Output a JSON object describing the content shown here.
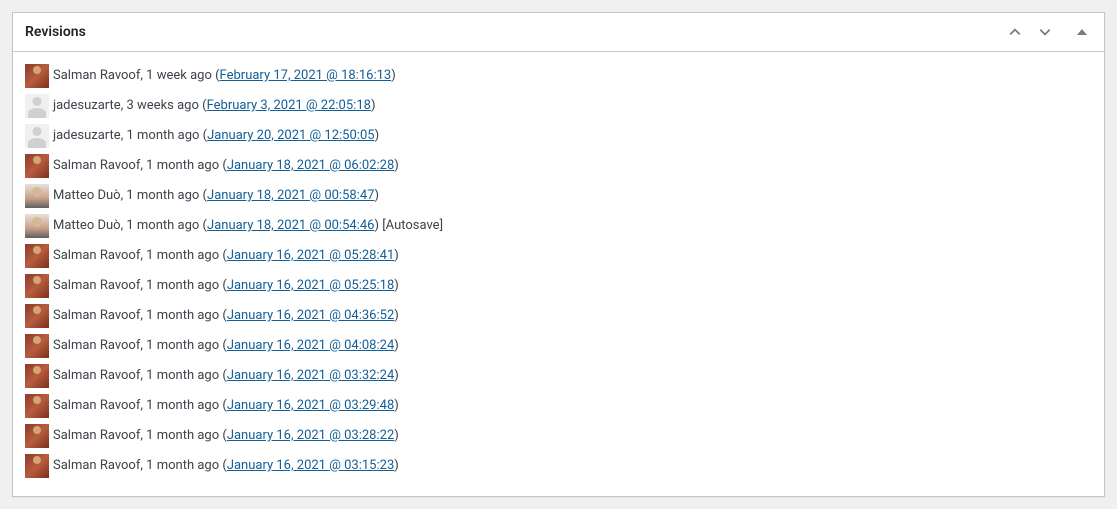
{
  "panel": {
    "title": "Revisions"
  },
  "revisions": [
    {
      "avatar": "sr",
      "author": "Salman Ravoof",
      "time_ago": "1 week ago",
      "date_link": "February 17, 2021 @ 18:16:13",
      "autosave": false
    },
    {
      "avatar": "ja",
      "author": "jadesuzarte",
      "time_ago": "3 weeks ago",
      "date_link": "February 3, 2021 @ 22:05:18",
      "autosave": false
    },
    {
      "avatar": "ja",
      "author": "jadesuzarte",
      "time_ago": "1 month ago",
      "date_link": "January 20, 2021 @ 12:50:05",
      "autosave": false
    },
    {
      "avatar": "sr",
      "author": "Salman Ravoof",
      "time_ago": "1 month ago",
      "date_link": "January 18, 2021 @ 06:02:28",
      "autosave": false
    },
    {
      "avatar": "md",
      "author": "Matteo Duò",
      "time_ago": "1 month ago",
      "date_link": "January 18, 2021 @ 00:58:47",
      "autosave": false
    },
    {
      "avatar": "md",
      "author": "Matteo Duò",
      "time_ago": "1 month ago",
      "date_link": "January 18, 2021 @ 00:54:46",
      "autosave": true
    },
    {
      "avatar": "sr",
      "author": "Salman Ravoof",
      "time_ago": "1 month ago",
      "date_link": "January 16, 2021 @ 05:28:41",
      "autosave": false
    },
    {
      "avatar": "sr",
      "author": "Salman Ravoof",
      "time_ago": "1 month ago",
      "date_link": "January 16, 2021 @ 05:25:18",
      "autosave": false
    },
    {
      "avatar": "sr",
      "author": "Salman Ravoof",
      "time_ago": "1 month ago",
      "date_link": "January 16, 2021 @ 04:36:52",
      "autosave": false
    },
    {
      "avatar": "sr",
      "author": "Salman Ravoof",
      "time_ago": "1 month ago",
      "date_link": "January 16, 2021 @ 04:08:24",
      "autosave": false
    },
    {
      "avatar": "sr",
      "author": "Salman Ravoof",
      "time_ago": "1 month ago",
      "date_link": "January 16, 2021 @ 03:32:24",
      "autosave": false
    },
    {
      "avatar": "sr",
      "author": "Salman Ravoof",
      "time_ago": "1 month ago",
      "date_link": "January 16, 2021 @ 03:29:48",
      "autosave": false
    },
    {
      "avatar": "sr",
      "author": "Salman Ravoof",
      "time_ago": "1 month ago",
      "date_link": "January 16, 2021 @ 03:28:22",
      "autosave": false
    },
    {
      "avatar": "sr",
      "author": "Salman Ravoof",
      "time_ago": "1 month ago",
      "date_link": "January 16, 2021 @ 03:15:23",
      "autosave": false
    }
  ],
  "autosave_label": "[Autosave]"
}
